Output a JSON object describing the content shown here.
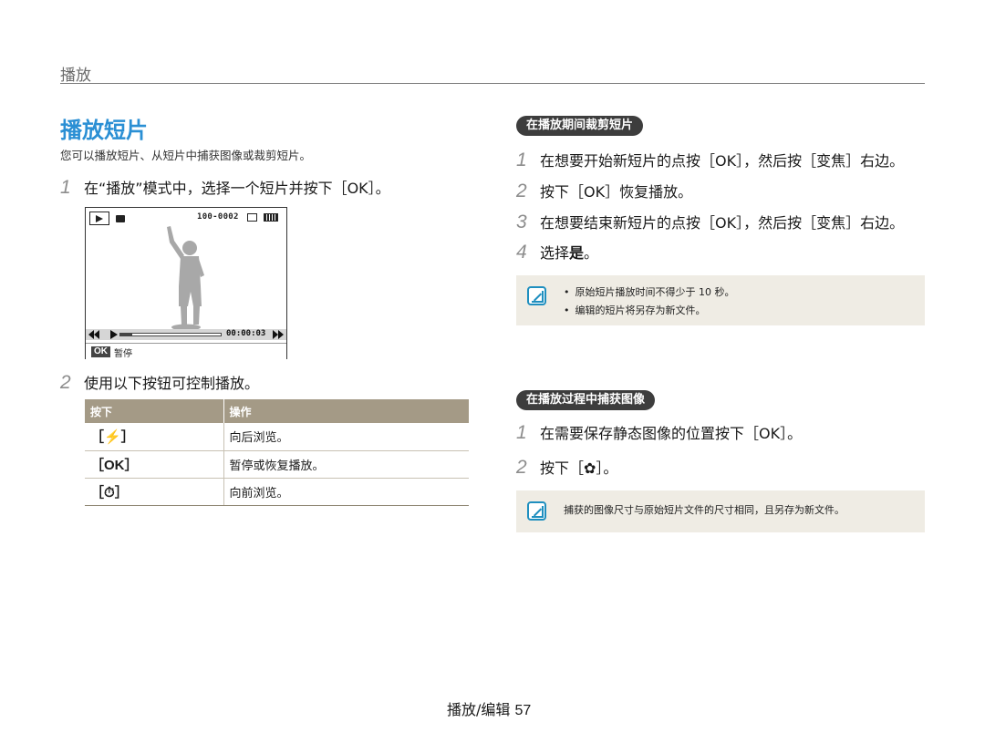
{
  "header": {
    "section": "播放"
  },
  "title": "播放短片",
  "intro": "您可以播放短片、从短片中捕获图像或裁剪短片。",
  "left_steps": [
    {
      "num": "1",
      "text": "在“播放”模式中，选择一个短片并按下［OK］。"
    },
    {
      "num": "2",
      "text": "使用以下按钮可控制播放。"
    }
  ],
  "camera_screen": {
    "file_number": "100-0002",
    "time": "00:00:03",
    "ok_key": "OK",
    "pause_label": "暂停",
    "progress_fraction": 0.12
  },
  "control_table": {
    "headers": [
      "按下",
      "操作"
    ],
    "rows": [
      {
        "button": "［⚡］",
        "action": "向后浏览。"
      },
      {
        "button": "［OK］",
        "action": "暂停或恢复播放。"
      },
      {
        "button": "［⏱］",
        "action": "向前浏览。"
      }
    ]
  },
  "trim": {
    "heading": "在播放期间裁剪短片",
    "steps": [
      {
        "num": "1",
        "text": "在想要开始新短片的点按［OK］，然后按［变焦］右边。"
      },
      {
        "num": "2",
        "text": "按下［OK］恢复播放。"
      },
      {
        "num": "3",
        "text": "在想要结束新短片的点按［OK］，然后按［变焦］右边。"
      },
      {
        "num": "4",
        "prefix": "选择",
        "bold": "是",
        "suffix": "。"
      }
    ],
    "notes": [
      "原始短片播放时间不得少于 10 秒。",
      "编辑的短片将另存为新文件。"
    ]
  },
  "capture": {
    "heading": "在播放过程中捕获图像",
    "steps": [
      {
        "num": "1",
        "text": "在需要保存静态图像的位置按下［OK］。"
      },
      {
        "num": "2",
        "text": "按下［✿］。"
      }
    ],
    "note": "捕获的图像尺寸与原始短片文件的尺寸相同，且另存为新文件。"
  },
  "footer": {
    "section": "播放/编辑",
    "page": "57"
  },
  "colors": {
    "title": "#2a8fd4",
    "table_header": "#a49a86",
    "note_bg": "#efece4",
    "pill_bg": "#3d3d3d"
  },
  "icons": [
    "playback-mode-icon",
    "movie-icon",
    "memory-card-icon",
    "battery-icon",
    "rewind-icon",
    "play-icon",
    "fast-forward-icon",
    "note-icon"
  ]
}
